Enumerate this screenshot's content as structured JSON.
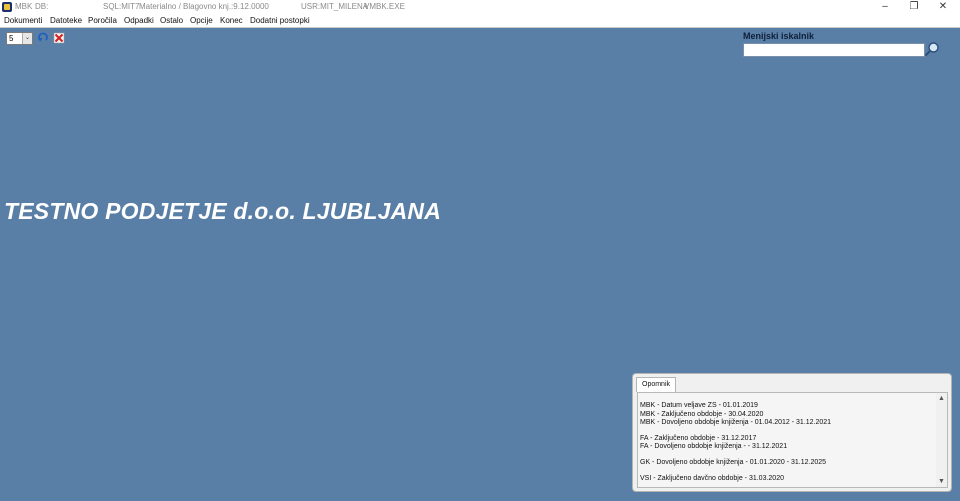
{
  "titlebar": {
    "app": "MBK",
    "db_label": "DB:",
    "sql": "SQL:MIT7",
    "module": "Materialno / Blagovno knj.:9.12.0000",
    "user": "USR:MIT_MILENA",
    "exe": "VMBK.EXE",
    "minimize": "–",
    "restore": "❐",
    "close": "✕"
  },
  "menu": [
    "Dokumenti",
    "Datoteke",
    "Poročila",
    "Odpadki",
    "Ostalo",
    "Opcije",
    "Konec",
    "Dodatni postopki"
  ],
  "toolbar": {
    "combo_value": "5",
    "combo_arrow": "⌄"
  },
  "search": {
    "title": "Menijski iskalnik",
    "value": "",
    "placeholder": ""
  },
  "company_name": "TESTNO PODJETJE d.o.o. LJUBLJANA",
  "reminder": {
    "tab": "Opomnik",
    "groups": [
      [
        "MBK - Datum veljave ZS - 01.01.2019",
        "MBK - Zaključeno obdobje - 30.04.2020",
        "MBK - Dovoljeno obdobje knjiženja - 01.04.2012 - 31.12.2021"
      ],
      [
        "FA - Zaključeno obdobje - 31.12.2017",
        "FA - Dovoljeno obdobje knjiženja -  - 31.12.2021"
      ],
      [
        "GK - Dovoljeno obdobje knjiženja - 01.01.2020 - 31.12.2025"
      ],
      [
        "VSI - Zaključeno davčno obdobje - 31.03.2020"
      ]
    ],
    "scroll_up": "▲",
    "scroll_down": "▼"
  },
  "colors": {
    "background": "#5a7fa6",
    "company_text": "#ffffff"
  }
}
